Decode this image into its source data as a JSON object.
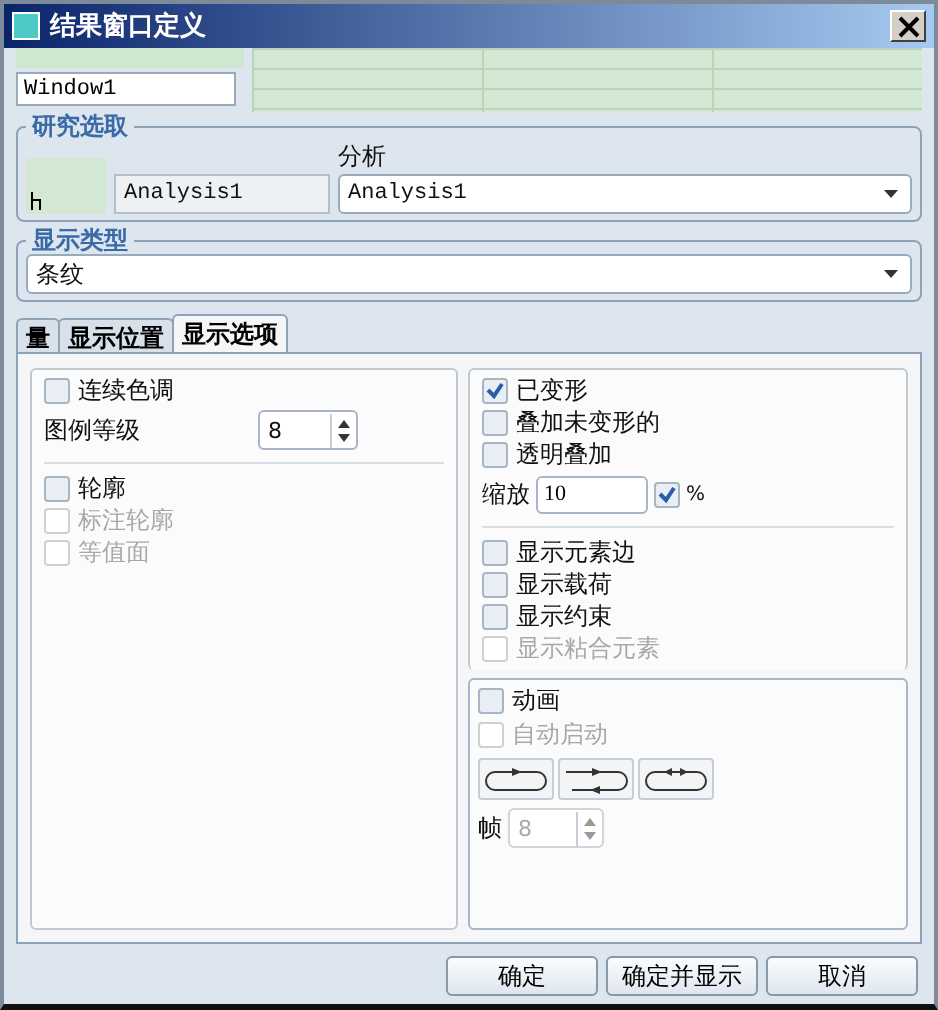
{
  "window": {
    "title": "结果窗口定义"
  },
  "name_field": {
    "value": "Window1"
  },
  "study_group": {
    "title": "研究选取",
    "study_value": "Analysis1",
    "analysis_label": "分析",
    "analysis_value": "Analysis1"
  },
  "display_type_group": {
    "title": "显示类型",
    "value": "条纹"
  },
  "tabs": [
    {
      "label": "量",
      "selected": false
    },
    {
      "label": "显示位置",
      "selected": false
    },
    {
      "label": "显示选项",
      "selected": true
    }
  ],
  "left_options": [
    {
      "kind": "checkbox",
      "label": "连续色调",
      "checked": false,
      "disabled": false
    },
    {
      "kind": "spinner",
      "label": "图例等级",
      "value": "8"
    },
    {
      "kind": "divider"
    },
    {
      "kind": "checkbox",
      "label": "轮廓",
      "checked": false,
      "disabled": false
    },
    {
      "kind": "checkbox",
      "label": "标注轮廓",
      "checked": false,
      "disabled": true
    },
    {
      "kind": "checkbox",
      "label": "等值面",
      "checked": false,
      "disabled": true
    }
  ],
  "right_options": [
    {
      "kind": "checkbox",
      "label": "已变形",
      "checked": true,
      "disabled": false
    },
    {
      "kind": "checkbox",
      "label": "叠加未变形的",
      "checked": false,
      "disabled": false
    },
    {
      "kind": "checkbox",
      "label": "透明叠加",
      "checked": false,
      "disabled": false
    },
    {
      "kind": "scale",
      "label": "缩放",
      "value": "10",
      "checked": true,
      "unit": "%"
    },
    {
      "kind": "divider"
    },
    {
      "kind": "checkbox",
      "label": "显示元素边",
      "checked": false,
      "disabled": false
    },
    {
      "kind": "checkbox",
      "label": "显示载荷",
      "checked": false,
      "disabled": false
    },
    {
      "kind": "checkbox",
      "label": "显示约束",
      "checked": false,
      "disabled": false
    },
    {
      "kind": "checkbox",
      "label": "显示粘合元素",
      "checked": false,
      "disabled": true
    }
  ],
  "animation": {
    "items": [
      {
        "label": "动画",
        "checked": false,
        "disabled": false
      },
      {
        "label": "自动启动",
        "checked": false,
        "disabled": true
      }
    ],
    "frames_label": "帧",
    "frames_value": "8",
    "frames_disabled": true
  },
  "buttons": [
    "确定",
    "确定并显示",
    "取消"
  ]
}
